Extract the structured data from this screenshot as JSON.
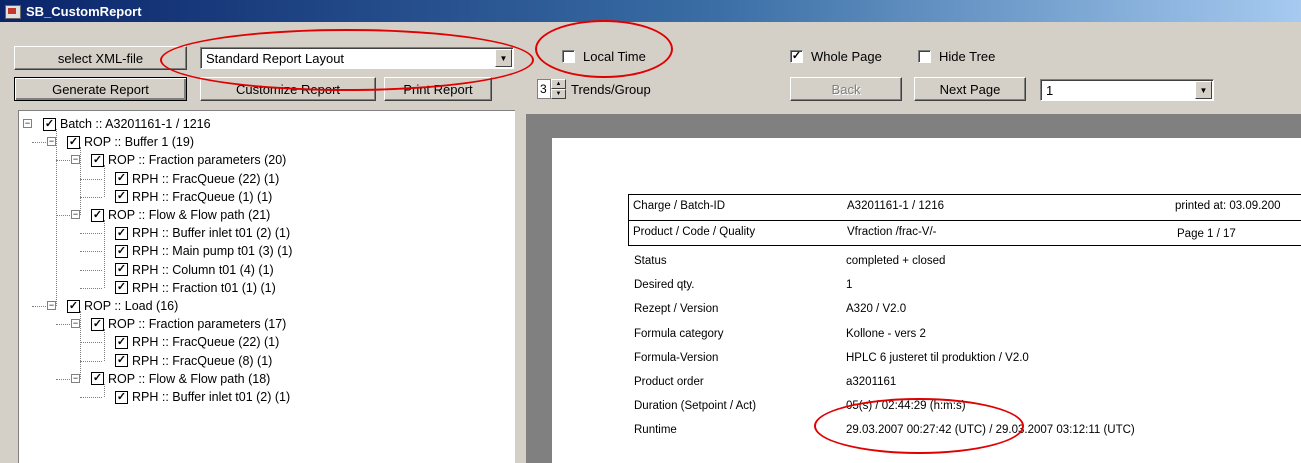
{
  "window": {
    "title": "SB_CustomReport",
    "icon": "app-icon"
  },
  "toolbar": {
    "select_xml": "select XML-file",
    "layout_value": "Standard Report Layout",
    "generate": "Generate Report",
    "customize": "Customize Report",
    "print": "Print Report",
    "local_time": {
      "label": "Local Time",
      "checked": false
    },
    "trends_value": "3",
    "trends_label": "Trends/Group",
    "whole_page": {
      "label": "Whole Page",
      "checked": true,
      "mark": "✓"
    },
    "hide_tree": {
      "label": "Hide Tree",
      "checked": false
    },
    "back": "Back",
    "next_page": "Next Page",
    "page_value": "1"
  },
  "tree": {
    "nodes": [
      {
        "label": "Batch :: A3201161-1 / 1216",
        "level": 0,
        "expander": "−",
        "checked": true
      },
      {
        "label": "ROP :: Buffer 1 (19)",
        "level": 1,
        "expander": "−",
        "checked": true
      },
      {
        "label": "ROP :: Fraction parameters (20)",
        "level": 2,
        "expander": "−",
        "checked": true
      },
      {
        "label": "RPH :: FracQueue (22) (1)",
        "level": 3,
        "expander": "",
        "checked": true
      },
      {
        "label": "RPH :: FracQueue (1) (1)",
        "level": 3,
        "expander": "",
        "checked": true
      },
      {
        "label": "ROP :: Flow & Flow path (21)",
        "level": 2,
        "expander": "−",
        "checked": true
      },
      {
        "label": "RPH :: Buffer inlet t01 (2) (1)",
        "level": 3,
        "expander": "",
        "checked": true
      },
      {
        "label": "RPH :: Main pump t01 (3) (1)",
        "level": 3,
        "expander": "",
        "checked": true
      },
      {
        "label": "RPH :: Column t01 (4) (1)",
        "level": 3,
        "expander": "",
        "checked": true
      },
      {
        "label": "RPH :: Fraction t01 (1) (1)",
        "level": 3,
        "expander": "",
        "checked": true
      },
      {
        "label": "ROP :: Load (16)",
        "level": 1,
        "expander": "−",
        "checked": true
      },
      {
        "label": "ROP :: Fraction parameters (17)",
        "level": 2,
        "expander": "−",
        "checked": true
      },
      {
        "label": "RPH :: FracQueue (22) (1)",
        "level": 3,
        "expander": "",
        "checked": true
      },
      {
        "label": "RPH :: FracQueue (8) (1)",
        "level": 3,
        "expander": "",
        "checked": true
      },
      {
        "label": "ROP :: Flow & Flow path (18)",
        "level": 2,
        "expander": "−",
        "checked": true
      },
      {
        "label": "RPH :: Buffer inlet t01 (2) (1)",
        "level": 3,
        "expander": "",
        "checked": true
      }
    ],
    "check_mark": "✓"
  },
  "report": {
    "header": {
      "batch_label": "Charge / Batch-ID",
      "batch_value": "A3201161-1 / 1216",
      "printed": "printed at: 03.09.200",
      "product_label": "Product / Code / Quality",
      "product_value": "Vfraction /frac-V/-",
      "page": "Page 1 / 17"
    },
    "rows": [
      {
        "label": "Status",
        "value": "completed + closed"
      },
      {
        "label": "Desired qty.",
        "value": "1"
      },
      {
        "label": "Rezept / Version",
        "value": "A320 / V2.0"
      },
      {
        "label": "Formula category",
        "value": "Kollone - vers 2"
      },
      {
        "label": "Formula-Version",
        "value": "HPLC 6 justeret til produktion / V2.0"
      },
      {
        "label": "Product order",
        "value": "a3201161"
      },
      {
        "label": "Duration (Setpoint / Act)",
        "value": "05(s) / 02:44:29 (h:m:s)"
      },
      {
        "label": "Runtime",
        "value": "29.03.2007 00:27:42 (UTC) / 29.03.2007 03:12:11 (UTC)"
      }
    ]
  },
  "colors": {
    "annotation": "#e00000",
    "face": "#d4d0c8",
    "title_start": "#0a246a"
  }
}
